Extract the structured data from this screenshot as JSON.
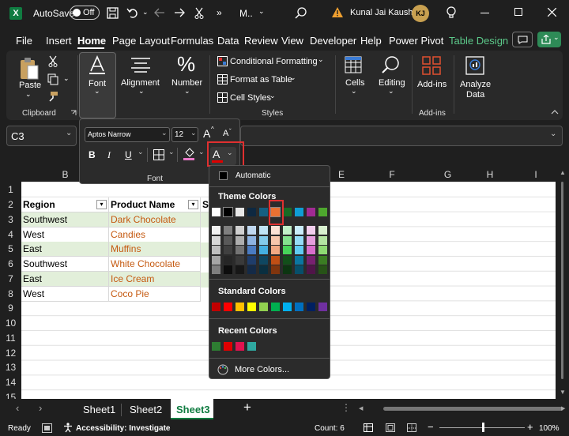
{
  "titlebar": {
    "app_letter": "X",
    "autosave_label": "AutoSave",
    "autosave_state": "Off",
    "file_name": "M..",
    "user_name": "Kunal Jai Kaushik",
    "user_initials": "KJ",
    "overflow": "»"
  },
  "menu": [
    "File",
    "Insert",
    "Home",
    "Page Layout",
    "Formulas",
    "Data",
    "Review",
    "View",
    "Developer",
    "Help",
    "Power Pivot",
    "Table Design"
  ],
  "menu_active": "Home",
  "ribbon": {
    "clipboard": {
      "paste": "Paste",
      "group": "Clipboard"
    },
    "font": "Font",
    "alignment": "Alignment",
    "number": "Number",
    "styles": {
      "cond": "Conditional Formatting",
      "table": "Format as Table",
      "cell": "Cell Styles",
      "group": "Styles"
    },
    "cells": "Cells",
    "editing": "Editing",
    "addins": {
      "label": "Add-ins",
      "group": "Add-ins"
    },
    "analyze": {
      "line1": "Analyze",
      "line2": "Data"
    }
  },
  "name_box": "C3",
  "columns": [
    "B",
    "E",
    "F",
    "G",
    "H",
    "I"
  ],
  "rows": [
    "1",
    "2",
    "3",
    "4",
    "5",
    "6",
    "7",
    "8",
    "9",
    "10",
    "11",
    "12",
    "13",
    "14",
    "15"
  ],
  "table": {
    "headers": [
      "Region",
      "Product Name",
      "S"
    ],
    "data": [
      [
        "Southwest",
        "Dark Chocolate"
      ],
      [
        "West",
        "Candies"
      ],
      [
        "East",
        "Muffins"
      ],
      [
        "Southwest",
        "White Chocolate"
      ],
      [
        "East",
        "Ice Cream"
      ],
      [
        "West",
        "Coco Pie"
      ]
    ]
  },
  "font_popup": {
    "font_name": "Aptos Narrow",
    "font_size": "12",
    "grow": "A",
    "shrink": "A",
    "bold": "B",
    "italic": "I",
    "underline": "U",
    "font_color_letter": "A",
    "group_label": "Font"
  },
  "color_popup": {
    "automatic": "Automatic",
    "theme_title": "Theme Colors",
    "standard_title": "Standard Colors",
    "recent_title": "Recent Colors",
    "more_colors": "More Colors..."
  },
  "theme_colors": [
    "#ffffff",
    "#000000",
    "#e8e8e8",
    "#0e2841",
    "#156082",
    "#e97132",
    "#196b24",
    "#0f9ed5",
    "#a02b93",
    "#4ea72e"
  ],
  "theme_shades": [
    [
      "#f2f2f2",
      "#7f7f7f",
      "#d0d0d0",
      "#c0d8f0",
      "#c1e4f5",
      "#fbe2d5",
      "#c1f0c8",
      "#caedfb",
      "#f2cfee",
      "#d9f2d0"
    ],
    [
      "#d8d8d8",
      "#595959",
      "#aeaeae",
      "#8db3e2",
      "#83cbeb",
      "#f7c7ac",
      "#83e28e",
      "#95dcf7",
      "#e59edd",
      "#b4e5a2"
    ],
    [
      "#bfbfbf",
      "#404040",
      "#747474",
      "#4a7bc1",
      "#45b0e1",
      "#f1a983",
      "#47d45a",
      "#61cbf3",
      "#d86dcb",
      "#8ed973"
    ],
    [
      "#a5a5a5",
      "#262626",
      "#3a3a3a",
      "#1f3d6b",
      "#0f4761",
      "#c04f15",
      "#124f1a",
      "#0b76a0",
      "#782170",
      "#3b7d23"
    ],
    [
      "#7f7f7f",
      "#0d0d0d",
      "#171717",
      "#142a47",
      "#0a2f40",
      "#80350e",
      "#0c3511",
      "#074f6a",
      "#501549",
      "#275317"
    ]
  ],
  "standard_colors": [
    "#c00000",
    "#ff0000",
    "#ffc000",
    "#ffff00",
    "#92d050",
    "#00b050",
    "#00b0f0",
    "#0070c0",
    "#002060",
    "#7030a0"
  ],
  "recent_colors": [
    "#2e7d32",
    "#e00000",
    "#e0134f",
    "#2fa8a0"
  ],
  "sheets": [
    "Sheet1",
    "Sheet2",
    "Sheet3"
  ],
  "active_sheet": "Sheet3",
  "status": {
    "ready": "Ready",
    "accessibility": "Accessibility: Investigate",
    "count": "Count: 6",
    "zoom": "100%",
    "minus": "−",
    "plus": "+"
  }
}
